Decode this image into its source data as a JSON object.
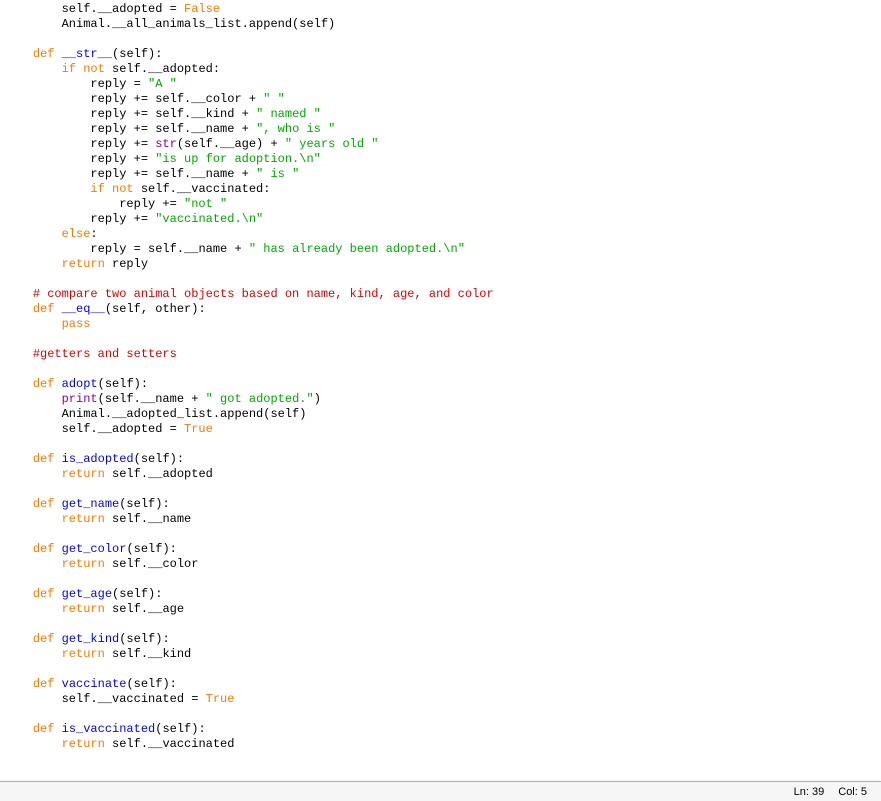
{
  "status": {
    "line_label": "Ln:",
    "line_value": "39",
    "col_label": "Col:",
    "col_value": "5"
  },
  "code": [
    {
      "i": "        ",
      "t": [
        {
          "c": "",
          "s": "self.__adopted = "
        },
        {
          "c": "kw",
          "s": "False"
        }
      ]
    },
    {
      "i": "        ",
      "t": [
        {
          "c": "",
          "s": "Animal.__all_animals_list.append(self)"
        }
      ]
    },
    {
      "i": "",
      "t": []
    },
    {
      "i": "    ",
      "t": [
        {
          "c": "kw",
          "s": "def"
        },
        {
          "c": "",
          "s": " "
        },
        {
          "c": "def",
          "s": "__str__"
        },
        {
          "c": "",
          "s": "(self):"
        }
      ]
    },
    {
      "i": "        ",
      "t": [
        {
          "c": "kw",
          "s": "if not"
        },
        {
          "c": "",
          "s": " self.__adopted:"
        }
      ]
    },
    {
      "i": "            ",
      "t": [
        {
          "c": "",
          "s": "reply = "
        },
        {
          "c": "str",
          "s": "\"A \""
        }
      ]
    },
    {
      "i": "            ",
      "t": [
        {
          "c": "",
          "s": "reply += self.__color + "
        },
        {
          "c": "str",
          "s": "\" \""
        }
      ]
    },
    {
      "i": "            ",
      "t": [
        {
          "c": "",
          "s": "reply += self.__kind + "
        },
        {
          "c": "str",
          "s": "\" named \""
        }
      ]
    },
    {
      "i": "            ",
      "t": [
        {
          "c": "",
          "s": "reply += self.__name + "
        },
        {
          "c": "str",
          "s": "\", who is \""
        }
      ]
    },
    {
      "i": "            ",
      "t": [
        {
          "c": "",
          "s": "reply += "
        },
        {
          "c": "bi",
          "s": "str"
        },
        {
          "c": "",
          "s": "(self.__age) + "
        },
        {
          "c": "str",
          "s": "\" years old \""
        }
      ]
    },
    {
      "i": "            ",
      "t": [
        {
          "c": "",
          "s": "reply += "
        },
        {
          "c": "str",
          "s": "\"is up for adoption.\\n\""
        }
      ]
    },
    {
      "i": "            ",
      "t": [
        {
          "c": "",
          "s": "reply += self.__name + "
        },
        {
          "c": "str",
          "s": "\" is \""
        }
      ]
    },
    {
      "i": "            ",
      "t": [
        {
          "c": "kw",
          "s": "if not"
        },
        {
          "c": "",
          "s": " self.__vaccinated:"
        }
      ]
    },
    {
      "i": "                ",
      "t": [
        {
          "c": "",
          "s": "reply += "
        },
        {
          "c": "str",
          "s": "\"not \""
        }
      ]
    },
    {
      "i": "            ",
      "t": [
        {
          "c": "",
          "s": "reply += "
        },
        {
          "c": "str",
          "s": "\"vaccinated.\\n\""
        }
      ]
    },
    {
      "i": "        ",
      "t": [
        {
          "c": "kw",
          "s": "else"
        },
        {
          "c": "",
          "s": ":"
        }
      ]
    },
    {
      "i": "            ",
      "t": [
        {
          "c": "",
          "s": "reply = self.__name + "
        },
        {
          "c": "str",
          "s": "\" has already been adopted.\\n\""
        }
      ]
    },
    {
      "i": "        ",
      "t": [
        {
          "c": "kw",
          "s": "return"
        },
        {
          "c": "",
          "s": " reply"
        }
      ]
    },
    {
      "i": "",
      "t": []
    },
    {
      "i": "    ",
      "t": [
        {
          "c": "comment",
          "s": "# compare two animal objects based on name, kind, age, and color"
        }
      ]
    },
    {
      "i": "    ",
      "t": [
        {
          "c": "kw",
          "s": "def"
        },
        {
          "c": "",
          "s": " "
        },
        {
          "c": "def",
          "s": "__eq__"
        },
        {
          "c": "",
          "s": "(self, other):"
        }
      ]
    },
    {
      "i": "        ",
      "t": [
        {
          "c": "kw",
          "s": "pass"
        }
      ]
    },
    {
      "i": "",
      "t": []
    },
    {
      "i": "    ",
      "t": [
        {
          "c": "comment",
          "s": "#getters and setters"
        }
      ]
    },
    {
      "i": "",
      "t": []
    },
    {
      "i": "    ",
      "t": [
        {
          "c": "kw",
          "s": "def"
        },
        {
          "c": "",
          "s": " "
        },
        {
          "c": "def",
          "s": "adopt"
        },
        {
          "c": "",
          "s": "(self):"
        }
      ]
    },
    {
      "i": "        ",
      "t": [
        {
          "c": "bi",
          "s": "print"
        },
        {
          "c": "",
          "s": "(self.__name + "
        },
        {
          "c": "str",
          "s": "\" got adopted.\""
        },
        {
          "c": "",
          "s": ")"
        }
      ]
    },
    {
      "i": "        ",
      "t": [
        {
          "c": "",
          "s": "Animal.__adopted_list.append(self)"
        }
      ]
    },
    {
      "i": "        ",
      "t": [
        {
          "c": "",
          "s": "self.__adopted = "
        },
        {
          "c": "kw",
          "s": "True"
        }
      ]
    },
    {
      "i": "",
      "t": []
    },
    {
      "i": "    ",
      "t": [
        {
          "c": "kw",
          "s": "def"
        },
        {
          "c": "",
          "s": " "
        },
        {
          "c": "def",
          "s": "is_adopted"
        },
        {
          "c": "",
          "s": "(self):"
        }
      ]
    },
    {
      "i": "        ",
      "t": [
        {
          "c": "kw",
          "s": "return"
        },
        {
          "c": "",
          "s": " self.__adopted"
        }
      ]
    },
    {
      "i": "",
      "t": []
    },
    {
      "i": "    ",
      "t": [
        {
          "c": "kw",
          "s": "def"
        },
        {
          "c": "",
          "s": " "
        },
        {
          "c": "def",
          "s": "get_name"
        },
        {
          "c": "",
          "s": "(self):"
        }
      ]
    },
    {
      "i": "        ",
      "t": [
        {
          "c": "kw",
          "s": "return"
        },
        {
          "c": "",
          "s": " self.__name"
        }
      ]
    },
    {
      "i": "",
      "t": []
    },
    {
      "i": "    ",
      "t": [
        {
          "c": "kw",
          "s": "def"
        },
        {
          "c": "",
          "s": " "
        },
        {
          "c": "def",
          "s": "get_color"
        },
        {
          "c": "",
          "s": "(self):"
        }
      ]
    },
    {
      "i": "        ",
      "t": [
        {
          "c": "kw",
          "s": "return"
        },
        {
          "c": "",
          "s": " self.__color"
        }
      ]
    },
    {
      "i": "",
      "t": []
    },
    {
      "i": "    ",
      "t": [
        {
          "c": "kw",
          "s": "def"
        },
        {
          "c": "",
          "s": " "
        },
        {
          "c": "def",
          "s": "get_age"
        },
        {
          "c": "",
          "s": "(self):"
        }
      ]
    },
    {
      "i": "        ",
      "t": [
        {
          "c": "kw",
          "s": "return"
        },
        {
          "c": "",
          "s": " self.__age"
        }
      ]
    },
    {
      "i": "",
      "t": []
    },
    {
      "i": "    ",
      "t": [
        {
          "c": "kw",
          "s": "def"
        },
        {
          "c": "",
          "s": " "
        },
        {
          "c": "def",
          "s": "get_kind"
        },
        {
          "c": "",
          "s": "(self):"
        }
      ]
    },
    {
      "i": "        ",
      "t": [
        {
          "c": "kw",
          "s": "return"
        },
        {
          "c": "",
          "s": " self.__kind"
        }
      ]
    },
    {
      "i": "",
      "t": []
    },
    {
      "i": "    ",
      "t": [
        {
          "c": "kw",
          "s": "def"
        },
        {
          "c": "",
          "s": " "
        },
        {
          "c": "def",
          "s": "vaccinate"
        },
        {
          "c": "",
          "s": "(self):"
        }
      ]
    },
    {
      "i": "        ",
      "t": [
        {
          "c": "",
          "s": "self.__vaccinated = "
        },
        {
          "c": "kw",
          "s": "True"
        }
      ]
    },
    {
      "i": "",
      "t": []
    },
    {
      "i": "    ",
      "t": [
        {
          "c": "kw",
          "s": "def"
        },
        {
          "c": "",
          "s": " "
        },
        {
          "c": "def",
          "s": "is_vaccinated"
        },
        {
          "c": "",
          "s": "(self):"
        }
      ]
    },
    {
      "i": "        ",
      "t": [
        {
          "c": "kw",
          "s": "return"
        },
        {
          "c": "",
          "s": " self.__vaccinated"
        }
      ]
    }
  ]
}
